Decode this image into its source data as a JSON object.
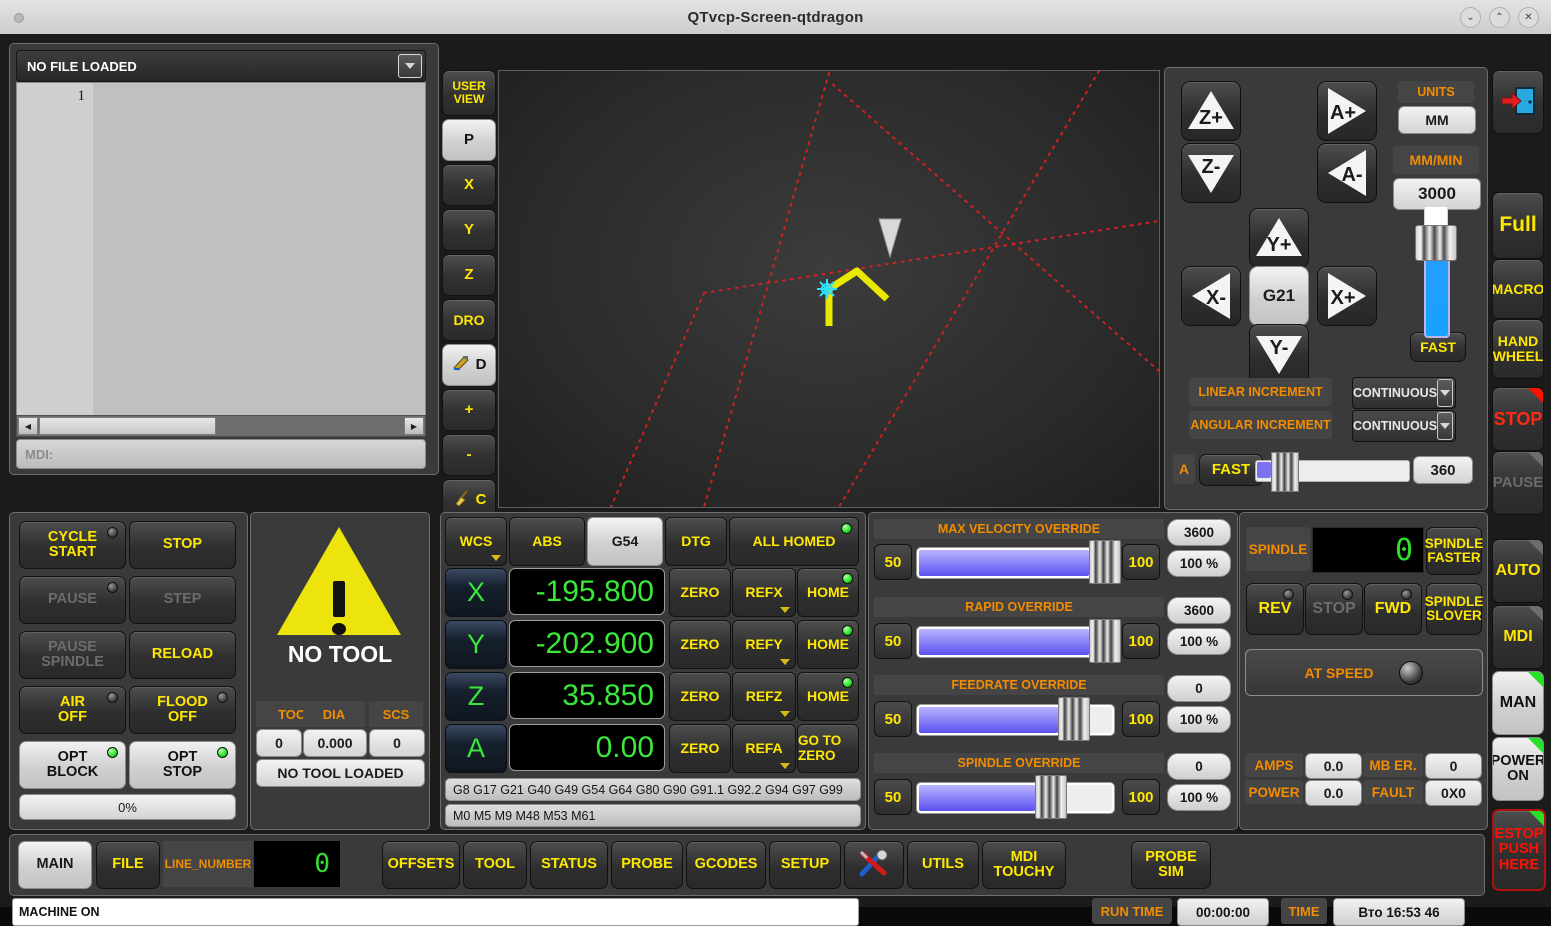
{
  "window": {
    "title": "QTvcp-Screen-qtdragon",
    "buttons": {
      "minimize": "⌄",
      "maximize": "⌃",
      "close": "✕"
    }
  },
  "gcode_file": {
    "header_label": "NO FILE LOADED",
    "line_numbers": [
      "1"
    ],
    "lines": [
      ""
    ],
    "mdi_prompt": "MDI:"
  },
  "view_toolbar": {
    "items": [
      {
        "label": "USER VIEW",
        "name": "view-user",
        "active": false
      },
      {
        "label": "P",
        "name": "view-perspective",
        "active": true
      },
      {
        "label": "X",
        "name": "view-x",
        "active": false
      },
      {
        "label": "Y",
        "name": "view-y",
        "active": false
      },
      {
        "label": "Z",
        "name": "view-z",
        "active": false
      },
      {
        "label": "DRO",
        "name": "view-dro",
        "active": false
      },
      {
        "label": "D",
        "name": "view-dimensions",
        "active": true
      },
      {
        "label": "+",
        "name": "view-zoom-in",
        "active": false
      },
      {
        "label": "-",
        "name": "view-zoom-out",
        "active": false
      },
      {
        "label": "C",
        "name": "view-clear",
        "active": false
      }
    ]
  },
  "jog": {
    "axes": [
      "Z+",
      "Z-",
      "A+",
      "A-",
      "Y+",
      "Y-",
      "X-",
      "X+"
    ],
    "center_label": "G21",
    "units_label": "UNITS",
    "units_value": "MM",
    "rate_label": "MM/MIN",
    "rate_value": "3000",
    "speed_label": "FAST",
    "linear_increment_label": "LINEAR INCREMENT",
    "linear_increment_value": "CONTINUOUS",
    "angular_increment_label": "ANGULAR INCREMENT",
    "angular_increment_value": "CONTINUOUS",
    "angular_axis": "A",
    "angular_speed_label": "FAST",
    "angular_value": "360"
  },
  "machine_control": {
    "cycle_start": "CYCLE\nSTART",
    "cycle_start_l1": "CYCLE",
    "cycle_start_l2": "START",
    "stop": "STOP",
    "pause": "PAUSE",
    "step": "STEP",
    "pause_spindle_l1": "PAUSE",
    "pause_spindle_l2": "SPINDLE",
    "reload": "RELOAD",
    "air_l1": "AIR",
    "air_l2": "OFF",
    "flood_l1": "FLOOD",
    "flood_l2": "OFF",
    "opt_block_l1": "OPT",
    "opt_block_l2": "BLOCK",
    "opt_stop_l1": "OPT",
    "opt_stop_l2": "STOP",
    "progress": "0%"
  },
  "tool_display": {
    "status": "NO TOOL",
    "headers": [
      "TOOL",
      "DIA",
      "SCS"
    ],
    "values": [
      "0",
      "0.000",
      "0"
    ],
    "loaded_text": "NO TOOL LOADED"
  },
  "dro": {
    "mode_buttons": [
      "WCS",
      "ABS",
      "G54",
      "DTG"
    ],
    "active_mode": "G54",
    "all_homed": "ALL HOMED",
    "axes": [
      {
        "name": "X",
        "value": "-195.800",
        "zero": "ZERO",
        "ref": "REFX",
        "home": "HOME",
        "homed": true
      },
      {
        "name": "Y",
        "value": "-202.900",
        "zero": "ZERO",
        "ref": "REFY",
        "home": "HOME",
        "homed": true
      },
      {
        "name": "Z",
        "value": "35.850",
        "zero": "ZERO",
        "ref": "REFZ",
        "home": "HOME",
        "homed": true
      },
      {
        "name": "A",
        "value": "0.00",
        "zero": "ZERO",
        "ref": "REFA",
        "home": "GO TO ZERO",
        "homed": false
      }
    ],
    "active_gcodes": "G8 G17 G21 G40 G49 G54 G64 G80 G90 G91.1 G92.2 G94 G97 G99",
    "active_mcodes": "M0 M5 M9 M48 M53 M61"
  },
  "overrides": [
    {
      "title": "MAX VELOCITY OVERRIDE",
      "min": "50",
      "max": "100",
      "value_abs": "3600",
      "value_pct": "100 %",
      "fill_pct": 88
    },
    {
      "title": "RAPID OVERRIDE",
      "min": "50",
      "max": "100",
      "value_abs": "3600",
      "value_pct": "100 %",
      "fill_pct": 88
    },
    {
      "title": "FEEDRATE OVERRIDE",
      "min": "50",
      "max": "100",
      "value_abs": "0",
      "value_pct": "100 %",
      "fill_pct": 72
    },
    {
      "title": "SPINDLE OVERRIDE",
      "min": "50",
      "max": "100",
      "value_abs": "0",
      "value_pct": "100 %",
      "fill_pct": 60
    }
  ],
  "spindle": {
    "label": "SPINDLE",
    "rpm": "0",
    "faster_l1": "SPINDLE",
    "faster_l2": "FASTER",
    "slower_l1": "SPINDLE",
    "slower_l2": "SLOVER",
    "rev": "REV",
    "stop": "STOP",
    "fwd": "FWD",
    "at_speed": "AT SPEED",
    "amps_label": "AMPS",
    "amps_value": "0.0",
    "power_label": "POWER",
    "power_value": "0.0",
    "mber_label": "MB ER.",
    "mber_value": "0",
    "fault_label": "FAULT",
    "fault_value": "0X0"
  },
  "right_strip": {
    "exit_icon": "exit-door-icon",
    "full": "Full",
    "macro": "MACRO",
    "hand_wheel_l1": "HAND",
    "hand_wheel_l2": "WHEEL",
    "stop": "STOP",
    "pause": "PAUSE",
    "auto": "AUTO",
    "mdi": "MDI",
    "man": "MAN",
    "power_on_l1": "POWER",
    "power_on_l2": "ON",
    "estop_l1": "ESTOP",
    "estop_l2": "PUSH",
    "estop_l3": "HERE"
  },
  "tabs": {
    "items": [
      {
        "label": "MAIN",
        "name": "tab-main",
        "active": true
      },
      {
        "label": "FILE",
        "name": "tab-file",
        "active": false
      },
      {
        "label": "OFFSETS",
        "name": "tab-offsets",
        "active": false
      },
      {
        "label": "TOOL",
        "name": "tab-tool",
        "active": false
      },
      {
        "label": "STATUS",
        "name": "tab-status",
        "active": false
      },
      {
        "label": "PROBE",
        "name": "tab-probe",
        "active": false
      },
      {
        "label": "GCODES",
        "name": "tab-gcodes",
        "active": false
      },
      {
        "label": "SETUP",
        "name": "tab-setup",
        "active": false
      },
      {
        "label": "UTILS",
        "name": "tab-utils",
        "active": false
      }
    ],
    "line_number_label": "LINE_NUMBER",
    "line_number_value": "0",
    "settings_icon": "tools-icon",
    "mdi_touchy_l1": "MDI",
    "mdi_touchy_l2": "TOUCHY",
    "probe_sim_l1": "PROBE",
    "probe_sim_l2": "SIM"
  },
  "statusbar": {
    "message": "MACHINE ON",
    "run_time_label": "RUN TIME",
    "run_time_value": "00:00:00",
    "time_label": "TIME",
    "time_value": "Вто 16:53 46"
  },
  "colors": {
    "accent_yellow": "#ffe800",
    "accent_orange": "#f28c00",
    "dro_green": "#3ae83a",
    "estop_red": "#ff1100",
    "panel_bg": "#3a3a3a"
  }
}
